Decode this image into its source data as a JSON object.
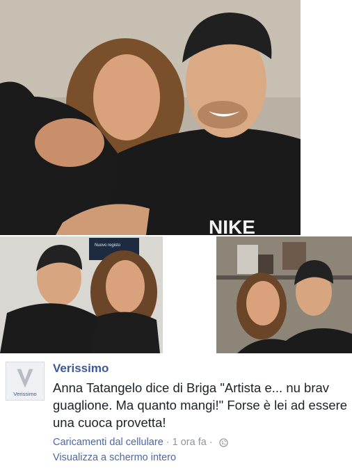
{
  "post": {
    "page_name": "Verissimo",
    "avatar_brand": "Verissimo",
    "text": "Anna Tatangelo dice di Briga \"Artista e... nu brav guaglione. Ma quanto mangi!\" Forse è lei ad essere una cuoca provetta!",
    "meta": {
      "source_link": "Caricamenti dal cellulare",
      "time": "1 ora fa",
      "privacy_icon": "globe-icon"
    },
    "fullscreen_link": "Visualizza a schermo intero"
  },
  "photos": {
    "main_shirt_text": "NIKE",
    "left_screen_text": "Nuovo registo"
  },
  "colors": {
    "link": "#3b5998",
    "text": "#1d2129",
    "meta": "#90949c"
  }
}
